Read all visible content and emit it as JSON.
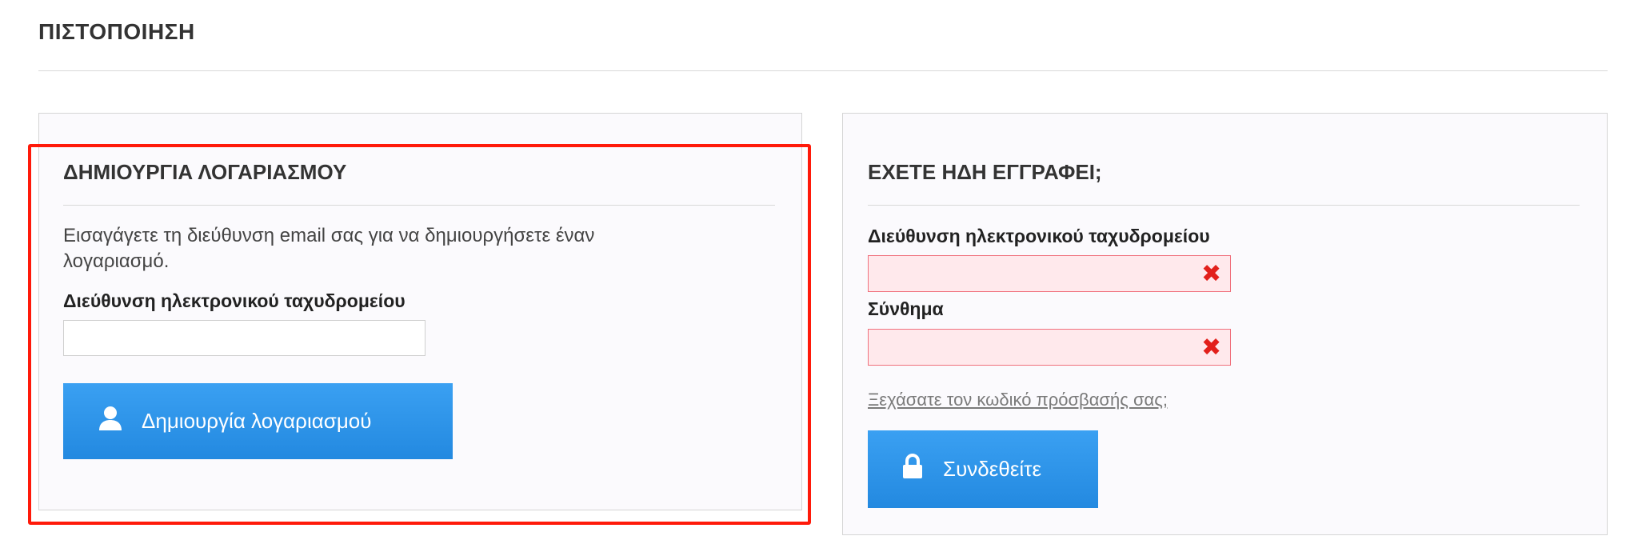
{
  "page": {
    "title": "ΠΙΣΤΟΠΟΙΗΣΗ"
  },
  "create_account": {
    "heading": "ΔΗΜΙΟΥΡΓΙΑ ΛΟΓΑΡΙΑΣΜΟΥ",
    "intro_line1": "Εισαγάγετε τη διεύθυνση email σας για να δημιουργήσετε έναν",
    "intro_line2": "λογαριασμό.",
    "email_label": "Διεύθυνση ηλεκτρονικού ταχυδρομείου",
    "email_value": "",
    "button_label": "Δημιουργία λογαριασμού",
    "button_icon": "user-icon"
  },
  "login": {
    "heading": "ΕΧΕΤΕ ΗΔΗ ΕΓΓΡΑΦΕΙ;",
    "email_label": "Διεύθυνση ηλεκτρονικού ταχυδρομείου",
    "email_value": "",
    "password_label": "Σύνθημα",
    "password_value": "",
    "forgot_link": "Ξεχάσατε τον κωδικό πρόσβασής σας;",
    "button_label": "Συνδεθείτε",
    "button_icon": "lock-icon",
    "error_icon": "error-x-icon"
  },
  "colors": {
    "button": "#2a91e8",
    "error": "#e2201b",
    "error_bg": "#ffe9ec",
    "highlight": "#ff1a0a"
  }
}
